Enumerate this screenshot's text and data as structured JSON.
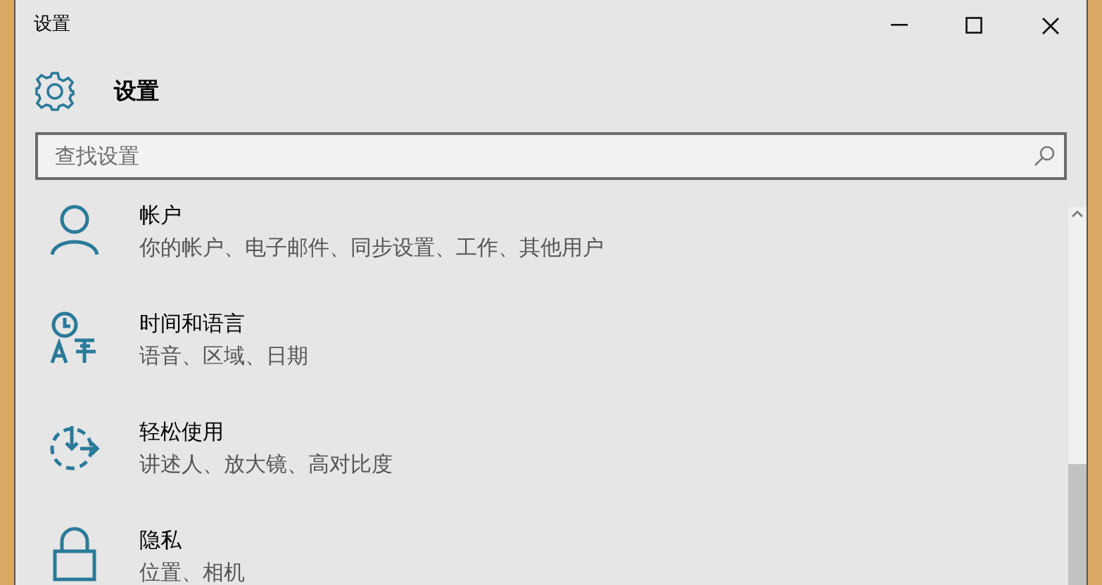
{
  "window": {
    "title": "设置"
  },
  "header": {
    "title": "设置"
  },
  "search": {
    "placeholder": "查找设置"
  },
  "items": [
    {
      "kind": "person",
      "title": "帐户",
      "subtitle": "你的帐户、电子邮件、同步设置、工作、其他用户"
    },
    {
      "kind": "time",
      "title": "时间和语言",
      "subtitle": "语音、区域、日期"
    },
    {
      "kind": "ease",
      "title": "轻松使用",
      "subtitle": "讲述人、放大镜、高对比度"
    },
    {
      "kind": "lock",
      "title": "隐私",
      "subtitle": "位置、相机"
    }
  ]
}
